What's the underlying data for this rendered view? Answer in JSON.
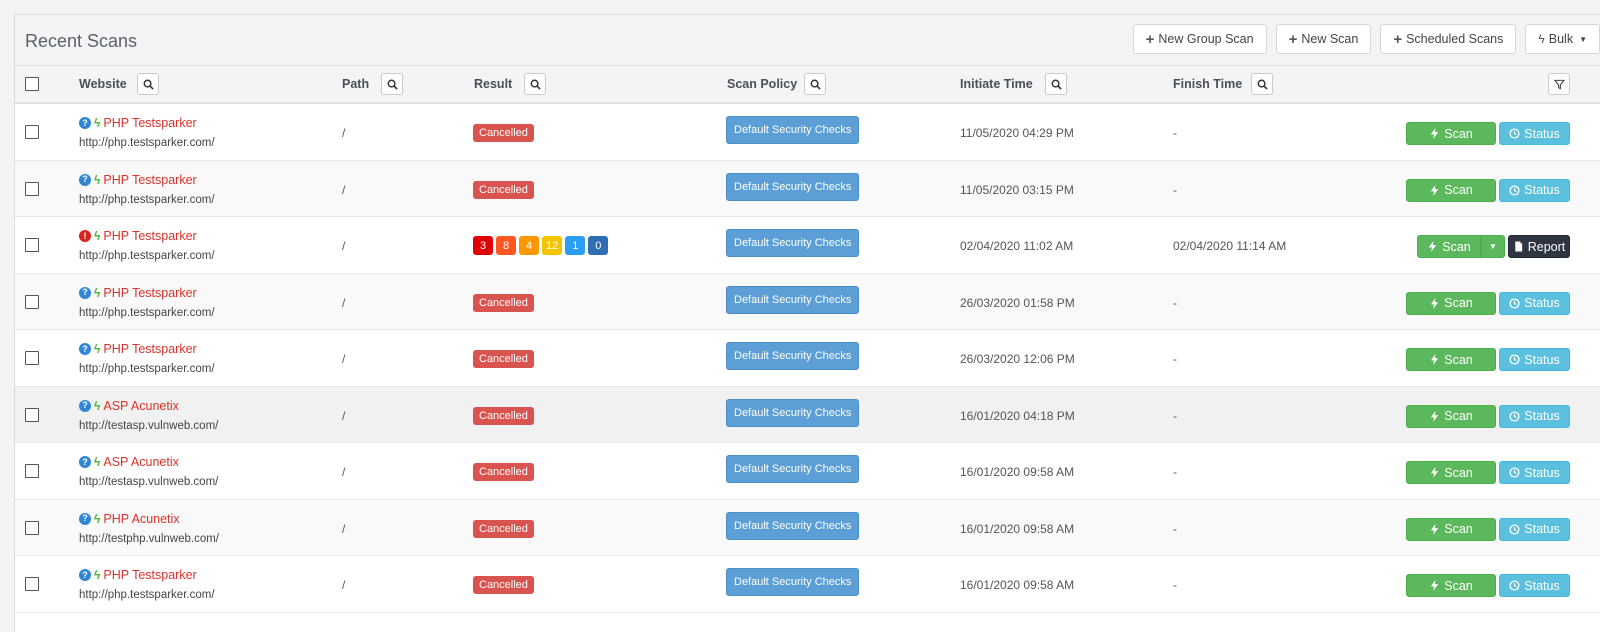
{
  "panel": {
    "title": "Recent Scans",
    "buttons": {
      "new_group_scan": "New Group Scan",
      "new_scan": "New Scan",
      "scheduled_scans": "Scheduled Scans",
      "bulk": "Bulk"
    }
  },
  "table": {
    "headers": {
      "website": "Website",
      "path": "Path",
      "result": "Result",
      "scan_policy": "Scan Policy",
      "initiate_time": "Initiate Time",
      "finish_time": "Finish Time"
    },
    "rows": [
      {
        "status": "unknown",
        "name": "PHP Testsparker",
        "url": "http://php.testsparker.com/",
        "path": "/",
        "result": "Cancelled",
        "policy": "Default Security Checks",
        "initiate": "11/05/2020 04:29 PM",
        "finish": "-"
      },
      {
        "status": "unknown",
        "name": "PHP Testsparker",
        "url": "http://php.testsparker.com/",
        "path": "/",
        "result": "Cancelled",
        "policy": "Default Security Checks",
        "initiate": "11/05/2020 03:15 PM",
        "finish": "-"
      },
      {
        "status": "error",
        "name": "PHP Testsparker",
        "url": "http://php.testsparker.com/",
        "path": "/",
        "result": "",
        "severity": [
          "3",
          "8",
          "4",
          "12",
          "1",
          "0"
        ],
        "policy": "Default Security Checks",
        "initiate": "02/04/2020 11:02 AM",
        "finish": "02/04/2020 11:14 AM"
      },
      {
        "status": "unknown",
        "name": "PHP Testsparker",
        "url": "http://php.testsparker.com/",
        "path": "/",
        "result": "Cancelled",
        "policy": "Default Security Checks",
        "initiate": "26/03/2020 01:58 PM",
        "finish": "-"
      },
      {
        "status": "unknown",
        "name": "PHP Testsparker",
        "url": "http://php.testsparker.com/",
        "path": "/",
        "result": "Cancelled",
        "policy": "Default Security Checks",
        "initiate": "26/03/2020 12:06 PM",
        "finish": "-"
      },
      {
        "status": "unknown",
        "name": "ASP Acunetix",
        "url": "http://testasp.vulnweb.com/",
        "path": "/",
        "result": "Cancelled",
        "policy": "Default Security Checks",
        "initiate": "16/01/2020 04:18 PM",
        "finish": "-"
      },
      {
        "status": "unknown",
        "name": "ASP Acunetix",
        "url": "http://testasp.vulnweb.com/",
        "path": "/",
        "result": "Cancelled",
        "policy": "Default Security Checks",
        "initiate": "16/01/2020 09:58 AM",
        "finish": "-"
      },
      {
        "status": "unknown",
        "name": "PHP Acunetix",
        "url": "http://testphp.vulnweb.com/",
        "path": "/",
        "result": "Cancelled",
        "policy": "Default Security Checks",
        "initiate": "16/01/2020 09:58 AM",
        "finish": "-"
      },
      {
        "status": "unknown",
        "name": "PHP Testsparker",
        "url": "http://php.testsparker.com/",
        "path": "/",
        "result": "Cancelled",
        "policy": "Default Security Checks",
        "initiate": "16/01/2020 09:58 AM",
        "finish": "-"
      }
    ],
    "actions": {
      "scan": "Scan",
      "status": "Status",
      "report": "Report"
    }
  },
  "colors": {
    "severity": [
      "#e00000",
      "#ff5722",
      "#ff9800",
      "#f5c400",
      "#2b9ef3",
      "#2f6db5"
    ],
    "scan_green": "#5cb85c",
    "status_blue": "#5bc0de",
    "cancelled_red": "#d9534f"
  }
}
